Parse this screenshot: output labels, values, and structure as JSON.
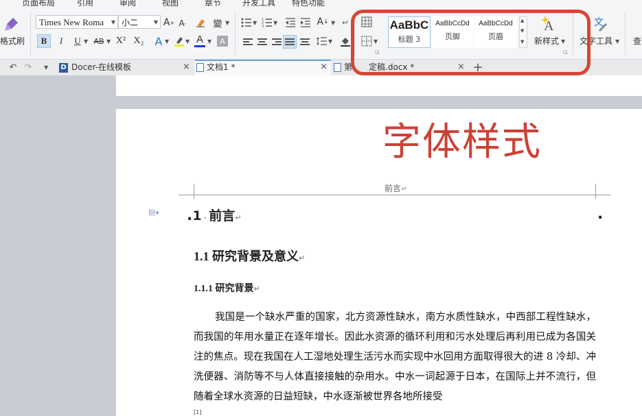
{
  "menubar": {
    "items": [
      "页面布局",
      "引用",
      "审阅",
      "视图",
      "章节",
      "开发工具",
      "特色功能"
    ]
  },
  "ribbon": {
    "format_painter_label": "格式刷",
    "font_name": "Times New Roma",
    "font_size": "小二",
    "bold": "B",
    "italic": "I",
    "underline": "U",
    "strike": "AB",
    "superscript": "X²",
    "subscript": "X₂",
    "font_color": "A",
    "grow_font": "A",
    "shrink_font": "A",
    "pinyin": "變",
    "styles": [
      {
        "preview": "AaBbC",
        "label": "标题 3"
      },
      {
        "preview": "AaBbCcDd",
        "label": "页脚"
      },
      {
        "preview": "AaBbCcDd",
        "label": "页眉"
      }
    ],
    "new_style_label": "新样式",
    "text_tools_label": "文字工具",
    "find_label": "查"
  },
  "tabs": [
    {
      "label": "Docer-在线模板"
    },
    {
      "label": "文档1 *"
    },
    {
      "label": "定稿.docx *",
      "prefix": "第"
    }
  ],
  "document": {
    "overlay_title": "字体样式",
    "header_text": "前言",
    "h1_number": "1",
    "h1_text": "前言",
    "h2": "1.1 研究背景及意义",
    "h3": "1.1.1 研究背景",
    "paragraph": "我国是一个缺水严重的国家，北方资源性缺水，南方水质性缺水，中西部工程性缺水，而我国的年用水量正在逐年增长。因此水资源的循环利用和污水处理后再利用已成为各国关注的焦点。现在我国在人工湿地处理生活污水而实现中水回用方面取得很大的进 8 冷却、冲洗便器、消防等不与人体直接接触的杂用水。中水一词起源于日本，在国际上并不流行，但随着全球水资源的日益短缺，中水逐渐被世界各地所接受",
    "footnote": "[1]"
  },
  "colors": {
    "highlight": "#d54735",
    "overlay_title": "#cc4136",
    "font_color_bar": "#1a3bd6"
  }
}
